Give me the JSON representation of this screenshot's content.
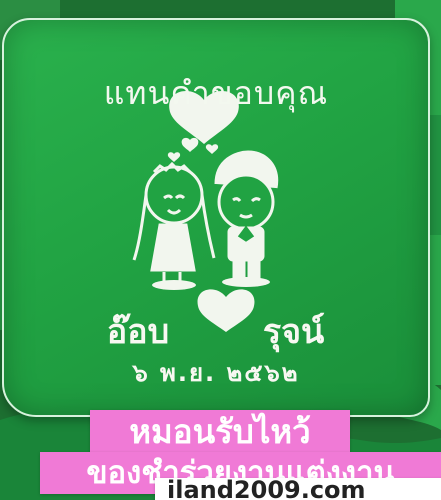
{
  "pillow": {
    "thanks_text": "แทนคำขอบคุณ",
    "names_left": "อ๊อบ",
    "names_right": "รุจน์",
    "date_text": "๖ พ.ย. ๒๕๖๒"
  },
  "banner": {
    "line1": "หมอนรับไหว้",
    "line2": "ของชำร่วยงานแต่งงาน",
    "line3": "iland2009.com"
  }
}
